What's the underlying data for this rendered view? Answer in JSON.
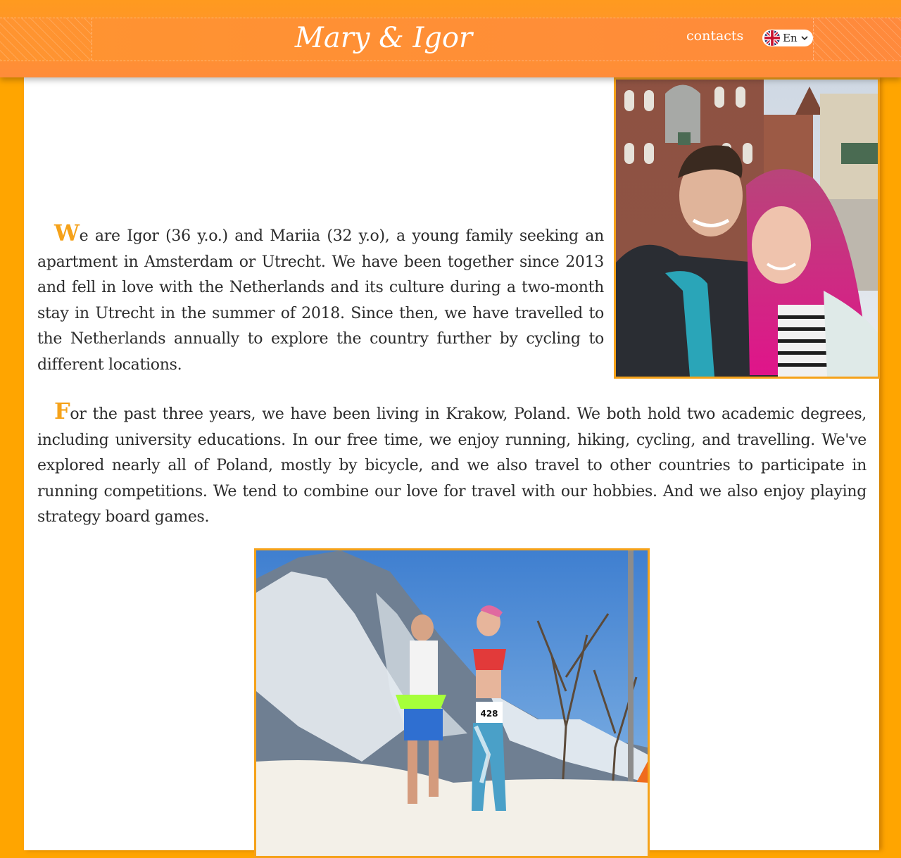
{
  "header": {
    "title": "Mary & Igor",
    "nav_contacts": "contacts",
    "language": {
      "selected": "En",
      "flag_icon": "uk-flag-icon",
      "chevron_icon": "chevron-down-icon"
    }
  },
  "colors": {
    "background": "#ffa500",
    "header": "#ff8c3a",
    "accent": "#f5a21a",
    "text": "#2b2b2b"
  },
  "about": {
    "p1_dropcap": "W",
    "p1_text": "e are Igor (36 y.o.) and Mariia (32 y.o), a young family seeking an apartment in Amsterdam or Utrecht. We have been together since 2013 and fell in love with the Netherlands and its culture during a two-month stay in Utrecht in the summer of 2018. Since then, we have travelled to the Netherlands annually to explore the country further by cycling to different locations.",
    "p2_dropcap": "F",
    "p2_text": "or the past three years, we have been living in Krakow, Poland. We both hold two academic degrees, including university educations. In our free time, we enjoy running, hiking, cycling, and travelling. We've explored nearly all of Poland, mostly by bicycle, and we also travel to other countries to participate in running competitions. We tend to combine our love for travel with our hobbies. And we also enjoy playing strategy board games."
  },
  "photo_bib": "428"
}
